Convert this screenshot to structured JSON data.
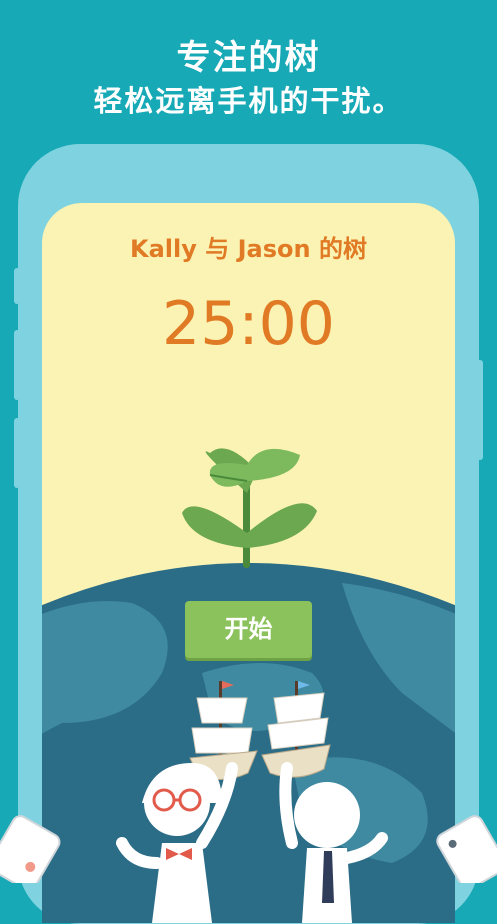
{
  "promo": {
    "headline": "专注的树",
    "subline": "轻松远离手机的干扰。"
  },
  "screen": {
    "title": "Kally 与 Jason 的树",
    "timer": "25:00",
    "start_label": "开始"
  },
  "colors": {
    "background": "#17a9b6",
    "phone_frame": "#7fd3e0",
    "screen_bg": "#fbf3b3",
    "accent_orange": "#e07a25",
    "start_button": "#8bc25b",
    "planet": "#2b6c87"
  },
  "icons": [
    "sprout-icon",
    "planet-illustration",
    "sailboat-icon",
    "phone-icon"
  ]
}
